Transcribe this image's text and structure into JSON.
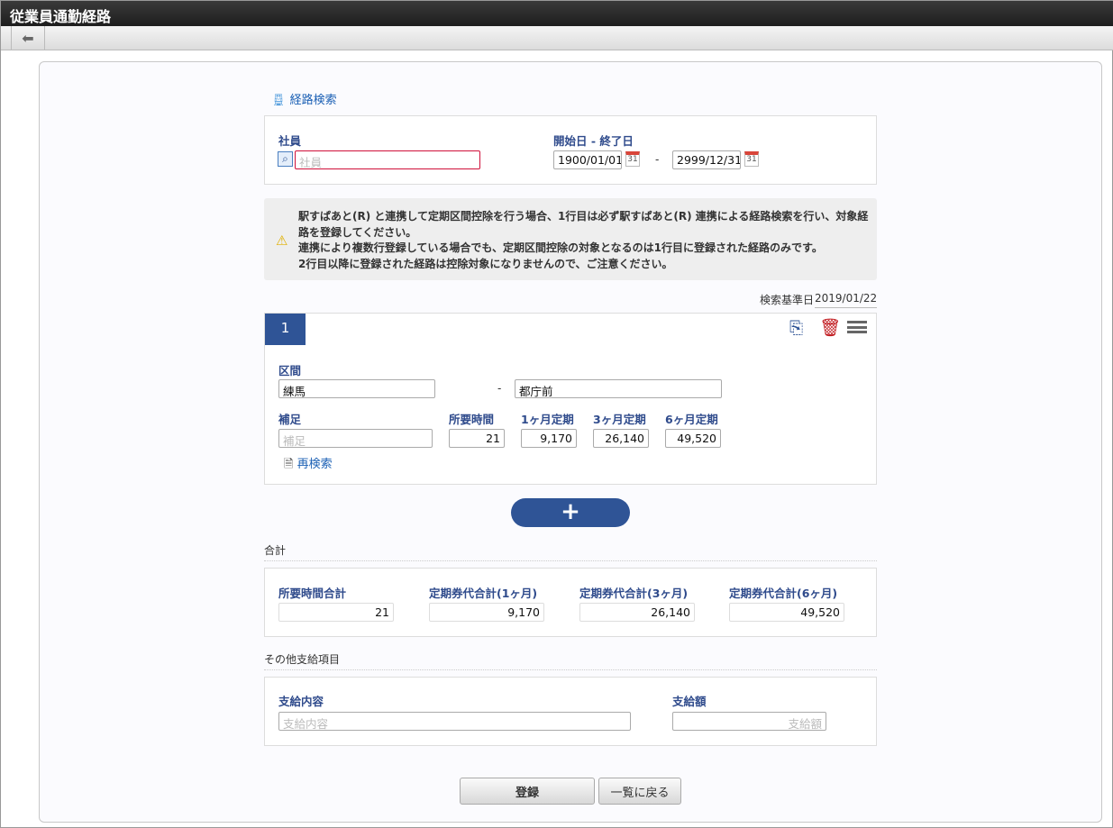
{
  "window": {
    "title": "従業員通勤経路",
    "back_icon": "arrow-left-icon"
  },
  "search": {
    "route_search_link": "経路検索",
    "employee_label": "社員",
    "employee_placeholder": "社員",
    "period_label": "開始日 - 終了日",
    "start_date": "1900/01/01",
    "end_date": "2999/12/31",
    "date_separator": "-",
    "calendar_icon_text": "31"
  },
  "notice": {
    "lines": [
      "駅すぱあと(R) と連携して定期区間控除を行う場合、1行目は必ず駅すぱあと(R) 連携による経路検索を行い、対象経",
      "路を登録してください。",
      "連携により複数行登録している場合でも、定期区間控除の対象となるのは1行目に登録された経路のみです。",
      "2行目以降に登録された経路は控除対象になりませんので、ご注意ください。"
    ]
  },
  "base_date": {
    "label": "検索基準日",
    "value": "2019/01/22"
  },
  "route": {
    "number": "1",
    "section_label": "区間",
    "from": "練馬",
    "to": "都庁前",
    "separator": "-",
    "note_label": "補足",
    "note_placeholder": "補足",
    "time_label": "所要時間",
    "time": "21",
    "m1_label": "1ヶ月定期",
    "m1": "9,170",
    "m3_label": "3ヶ月定期",
    "m3": "26,140",
    "m6_label": "6ヶ月定期",
    "m6": "49,520",
    "research_link": "再検索"
  },
  "totals": {
    "heading": "合計",
    "time_label": "所要時間合計",
    "time": "21",
    "m1_label": "定期券代合計(1ヶ月)",
    "m1": "9,170",
    "m3_label": "定期券代合計(3ヶ月)",
    "m3": "26,140",
    "m6_label": "定期券代合計(6ヶ月)",
    "m6": "49,520"
  },
  "other": {
    "heading": "その他支給項目",
    "content_label": "支給内容",
    "content_placeholder": "支給内容",
    "amount_label": "支給額",
    "amount_placeholder": "支給額"
  },
  "buttons": {
    "register": "登録",
    "back_to_list": "一覧に戻る",
    "add": "+"
  },
  "colors": {
    "accent": "#2f5496",
    "delete": "#c0161b",
    "required": "#d0103a"
  }
}
